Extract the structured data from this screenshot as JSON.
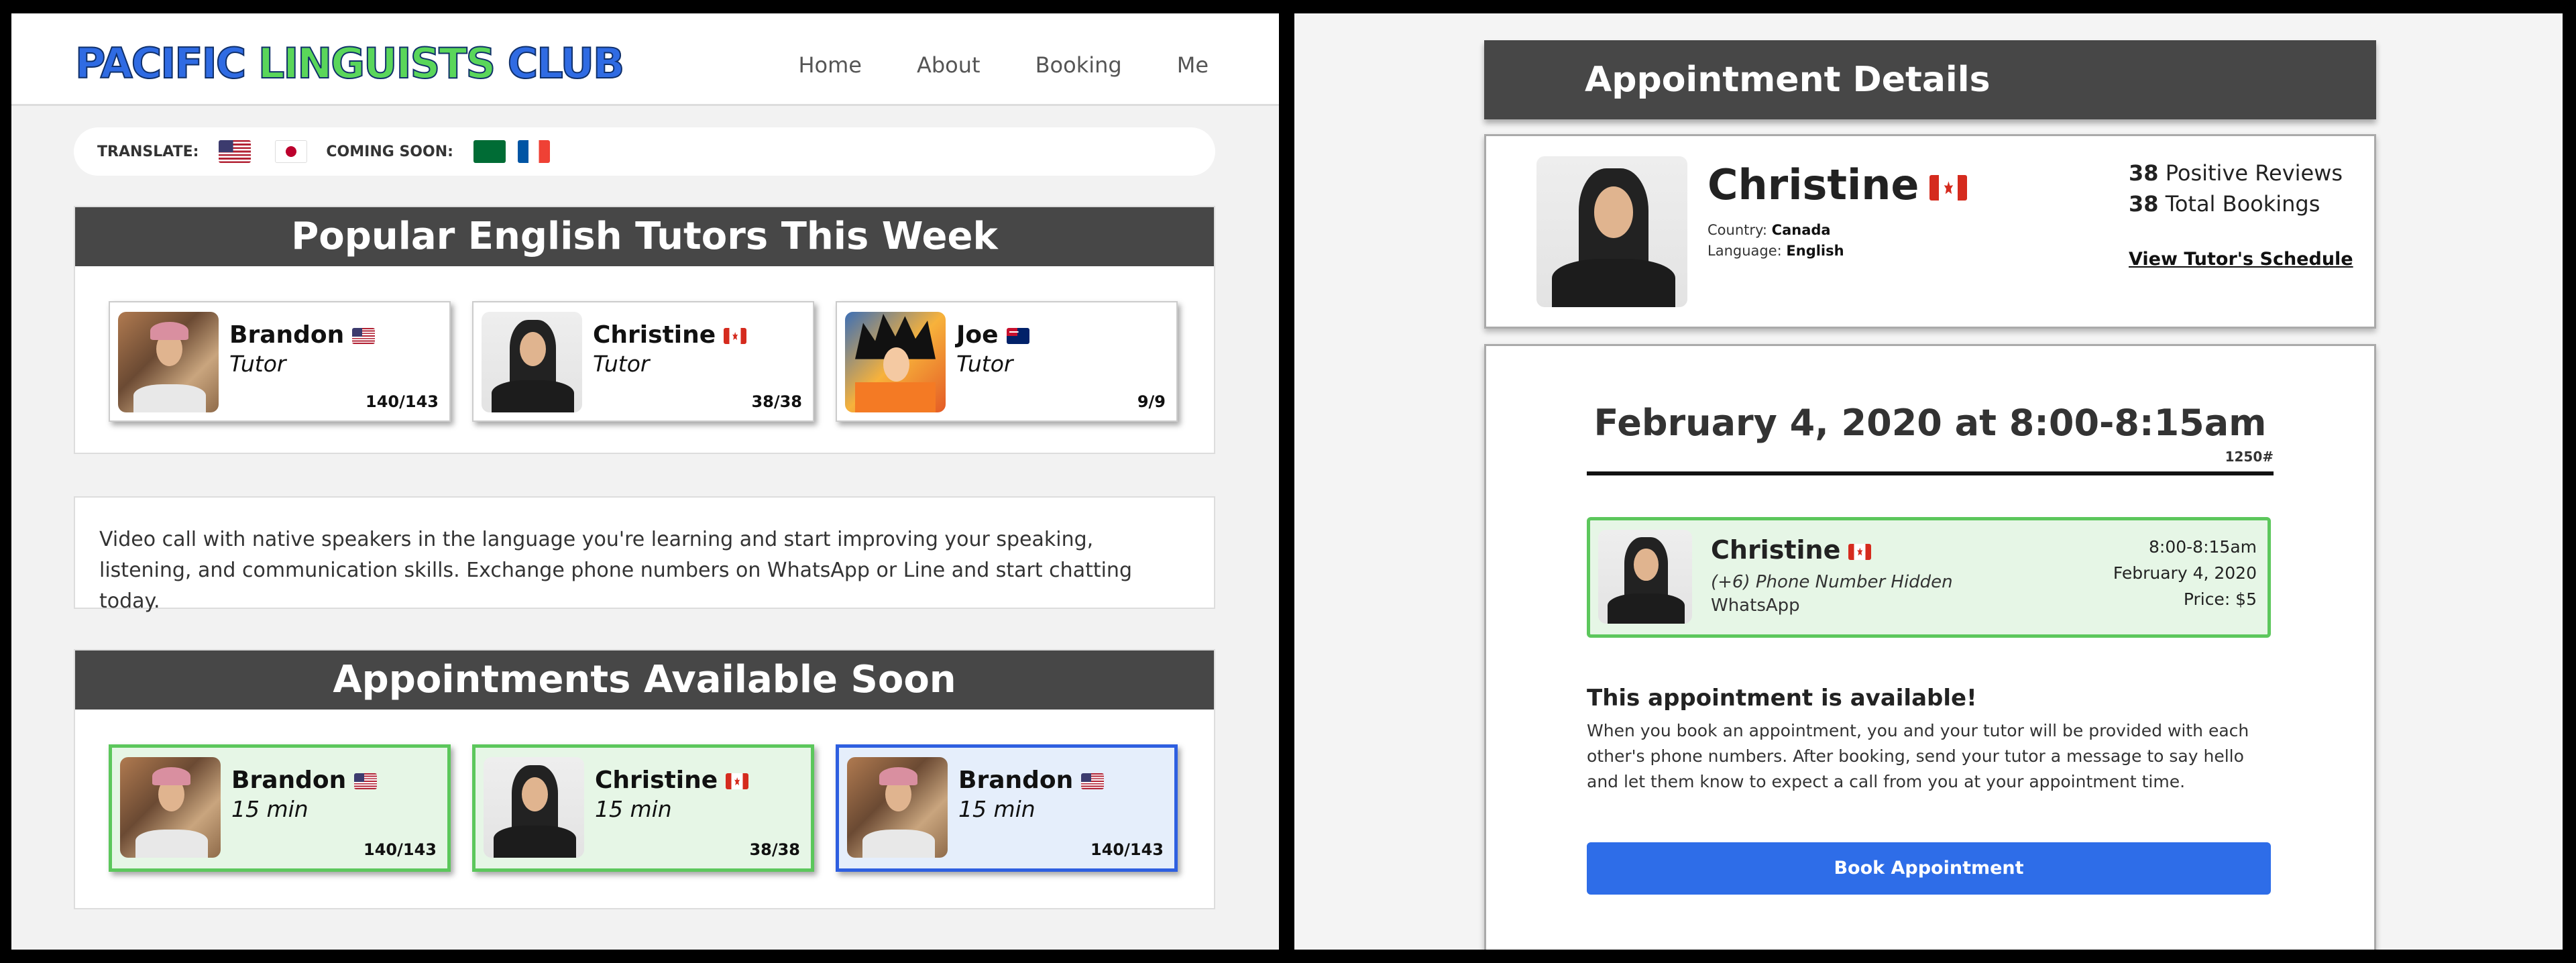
{
  "left": {
    "logo": {
      "word1": "PACIFIC",
      "word2": "LINGUISTS",
      "word3": "CLUB",
      "colors": [
        "#2f6be3",
        "#5ad65a",
        "#2f6be3"
      ]
    },
    "nav": [
      "Home",
      "About",
      "Booking",
      "Me"
    ],
    "translate": {
      "label": "TRANSLATE:",
      "coming_soon": "COMING SOON:"
    },
    "popular": {
      "title": "Popular English Tutors This Week",
      "tutors": [
        {
          "name": "Brandon",
          "role": "Tutor",
          "count": "140/143"
        },
        {
          "name": "Christine",
          "role": "Tutor",
          "count": "38/38"
        },
        {
          "name": "Joe",
          "role": "Tutor",
          "count": "9/9"
        }
      ]
    },
    "description": "Video call with native speakers in the language you're learning and start improving your speaking, listening, and communication skills. Exchange phone numbers on WhatsApp or Line and start chatting today.",
    "appointments": {
      "title": "Appointments Available Soon",
      "items": [
        {
          "name": "Brandon",
          "duration": "15 min",
          "count": "140/143"
        },
        {
          "name": "Christine",
          "duration": "15 min",
          "count": "38/38"
        },
        {
          "name": "Brandon",
          "duration": "15 min",
          "count": "140/143"
        }
      ]
    }
  },
  "right": {
    "title": "Appointment Details",
    "tutor": {
      "name": "Christine",
      "country_label": "Country:",
      "country": "Canada",
      "language_label": "Language:",
      "language": "English",
      "positive_count": "38",
      "positive_label": "Positive Reviews",
      "total_count": "38",
      "total_label": "Total Bookings",
      "schedule_link": "View Tutor's Schedule"
    },
    "booking": {
      "date_heading": "February 4, 2020 at 8:00-8:15am",
      "code": "1250#",
      "card": {
        "name": "Christine",
        "phone": "(+6) Phone Number Hidden",
        "app": "WhatsApp",
        "time": "8:00-8:15am",
        "date": "February 4, 2020",
        "price": "Price: $5"
      },
      "available_title": "This appointment is available!",
      "info": "When you book an appointment, you and your tutor will be provided with each other's phone numbers. After booking, send your tutor a message to say hello and let them know to expect a call from you at your appointment time.",
      "button": "Book Appointment"
    },
    "colors": {
      "available_green": "#5cc75c",
      "selected_blue": "#2e5fe0",
      "button_blue": "#2e6de8",
      "header_gray": "#474747"
    }
  }
}
